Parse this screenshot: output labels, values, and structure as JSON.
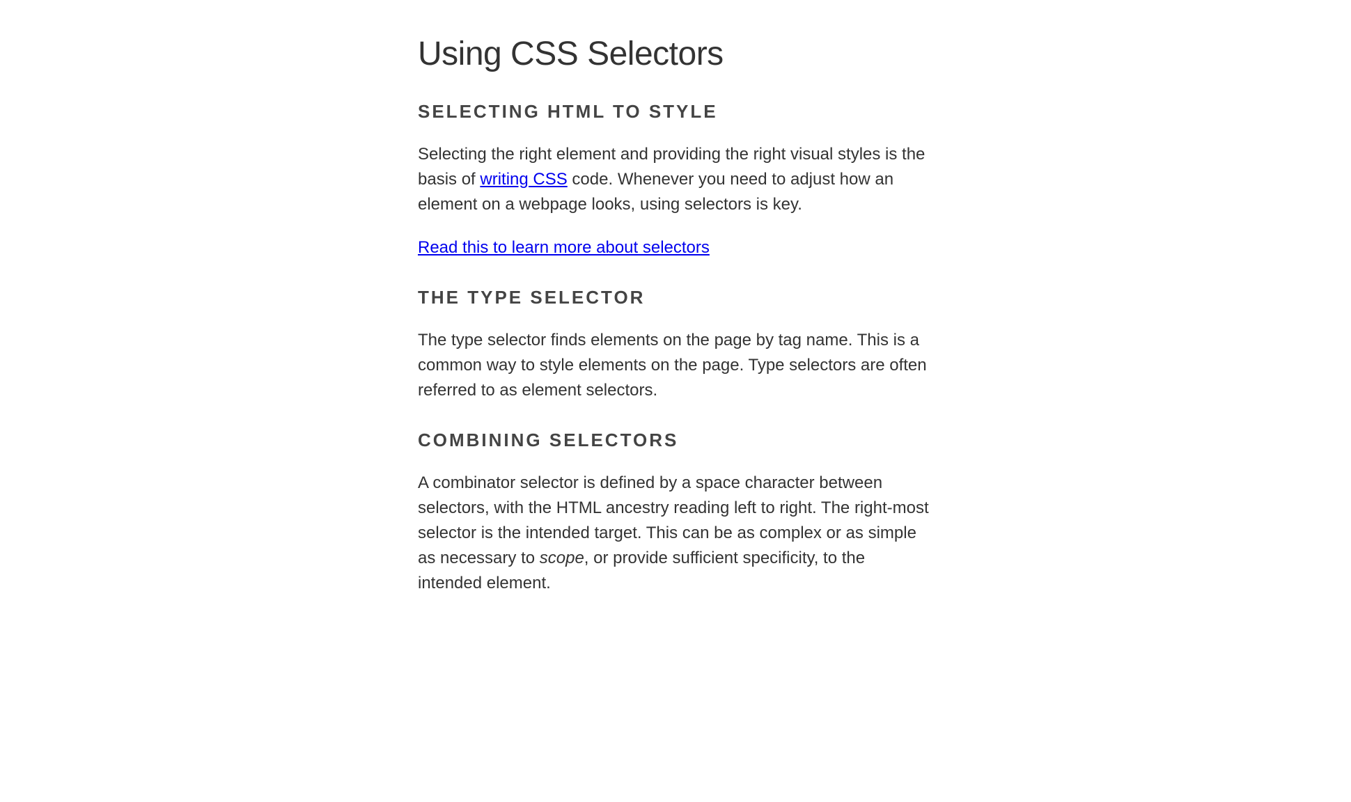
{
  "title": "Using CSS Selectors",
  "sections": [
    {
      "heading": "SELECTING HTML TO STYLE",
      "paragraph_before_link": "Selecting the right element and providing the right visual styles is the basis of ",
      "inline_link_text": "writing CSS",
      "paragraph_after_link": " code. Whenever you need to adjust how an element on a webpage looks, using selectors is key.",
      "standalone_link": "Read this to learn more about selectors"
    },
    {
      "heading": "THE TYPE SELECTOR",
      "paragraph": "The type selector finds elements on the page by tag name. This is a common way to style elements on the page. Type selectors are often referred to as element selectors."
    },
    {
      "heading": "COMBINING SELECTORS",
      "paragraph_before_em": "A combinator selector is defined by a space character between selectors, with the HTML ancestry reading left to right. The right-most selector is the intended target. This can be as complex or as simple as necessary to ",
      "em_text": "scope",
      "paragraph_after_em": ", or provide sufficient specificity, to the intended element."
    }
  ]
}
